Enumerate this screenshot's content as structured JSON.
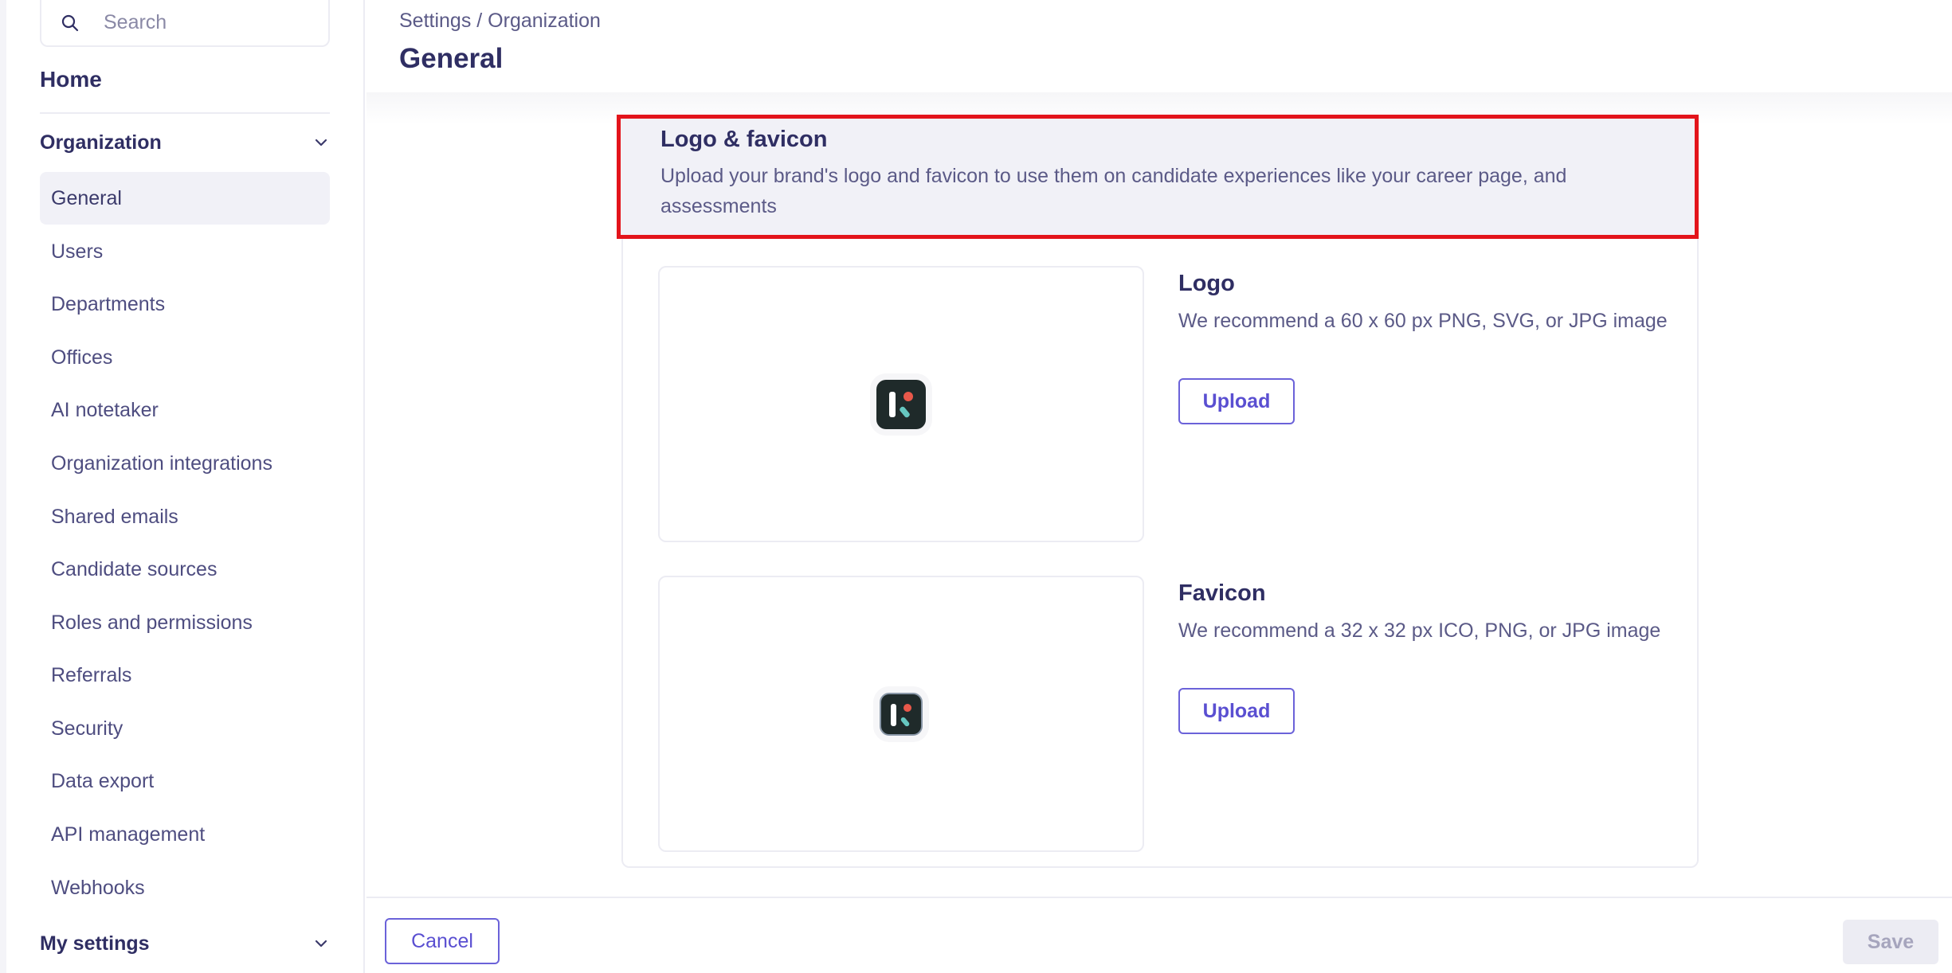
{
  "sidebar": {
    "search": {
      "placeholder": "Search"
    },
    "home_label": "Home",
    "organization_label": "Organization",
    "items": [
      {
        "label": "General",
        "active": true
      },
      {
        "label": "Users"
      },
      {
        "label": "Departments"
      },
      {
        "label": "Offices"
      },
      {
        "label": "AI notetaker"
      },
      {
        "label": "Organization integrations"
      },
      {
        "label": "Shared emails"
      },
      {
        "label": "Candidate sources"
      },
      {
        "label": "Roles and permissions"
      },
      {
        "label": "Referrals"
      },
      {
        "label": "Security"
      },
      {
        "label": "Data export"
      },
      {
        "label": "API management"
      },
      {
        "label": "Webhooks"
      }
    ],
    "my_settings_label": "My settings"
  },
  "header": {
    "breadcrumb": "Settings / Organization",
    "title": "General"
  },
  "card": {
    "title": "Logo & favicon",
    "description": "Upload your brand's logo and favicon to use them on candidate experiences like your career page, and assessments",
    "logo": {
      "title": "Logo",
      "description": "We recommend a 60 x 60 px PNG, SVG, or JPG image",
      "upload_label": "Upload"
    },
    "favicon": {
      "title": "Favicon",
      "description": "We recommend a 32 x 32 px ICO, PNG, or JPG image",
      "upload_label": "Upload"
    }
  },
  "footer": {
    "cancel_label": "Cancel",
    "save_label": "Save"
  },
  "colors": {
    "accent": "#5a4fd1",
    "highlight_border": "#e3141b",
    "logo_dark": "#1f2a2a",
    "logo_dot": "#e8584a",
    "logo_tick": "#66c7c0"
  },
  "icons": [
    "search-icon",
    "chevron-down-icon",
    "brand-logo-icon",
    "brand-favicon-icon"
  ]
}
